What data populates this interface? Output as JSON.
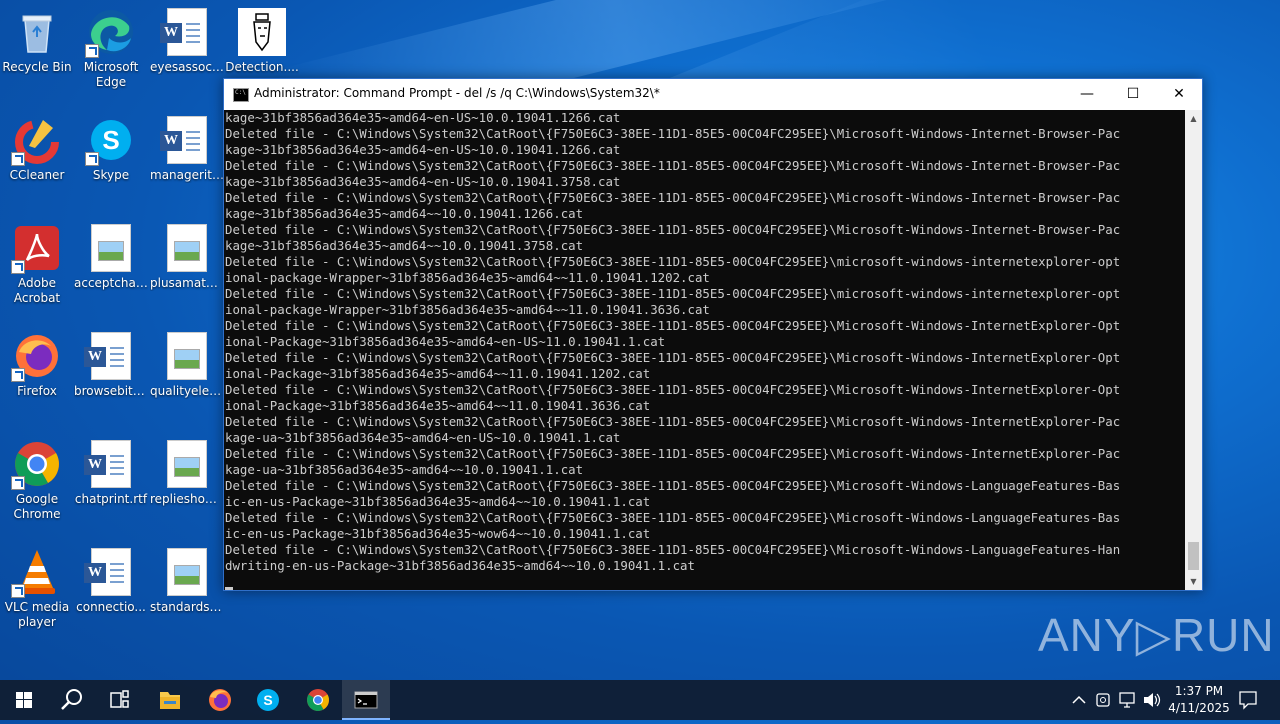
{
  "desktop": {
    "icons": [
      {
        "label": "Recycle Bin",
        "icon": "recycle-bin-icon"
      },
      {
        "label": "Microsoft Edge",
        "icon": "edge-icon"
      },
      {
        "label": "eyesassoci...",
        "icon": "word-doc-icon"
      },
      {
        "label": "Detection....",
        "icon": "image-file-icon"
      },
      {
        "label": "CCleaner",
        "icon": "ccleaner-icon"
      },
      {
        "label": "Skype",
        "icon": "skype-icon"
      },
      {
        "label": "managerite...",
        "icon": "word-doc-icon"
      },
      {
        "label": "Adobe Acrobat",
        "icon": "acrobat-icon"
      },
      {
        "label": "acceptchat....",
        "icon": "image-file-icon"
      },
      {
        "label": "plusamate....",
        "icon": "image-file-icon"
      },
      {
        "label": "Firefox",
        "icon": "firefox-icon"
      },
      {
        "label": "browsebit.rtf",
        "icon": "word-doc-icon"
      },
      {
        "label": "qualityelec...",
        "icon": "image-file-icon"
      },
      {
        "label": "Google Chrome",
        "icon": "chrome-icon"
      },
      {
        "label": "chatprint.rtf",
        "icon": "word-doc-icon"
      },
      {
        "label": "replieshous...",
        "icon": "image-file-icon"
      },
      {
        "label": "VLC media player",
        "icon": "vlc-icon"
      },
      {
        "label": "connectio...",
        "icon": "word-doc-icon"
      },
      {
        "label": "standardsc...",
        "icon": "image-file-icon"
      }
    ]
  },
  "window": {
    "title": "Administrator: Command Prompt - del  /s /q C:\\Windows\\System32\\*",
    "minimize": "—",
    "maximize": "☐",
    "close": "✕",
    "lines": [
      "kage~31bf3856ad364e35~amd64~en-US~10.0.19041.1266.cat",
      "Deleted file - C:\\Windows\\System32\\CatRoot\\{F750E6C3-38EE-11D1-85E5-00C04FC295EE}\\Microsoft-Windows-Internet-Browser-Pac",
      "kage~31bf3856ad364e35~amd64~en-US~10.0.19041.1266.cat",
      "Deleted file - C:\\Windows\\System32\\CatRoot\\{F750E6C3-38EE-11D1-85E5-00C04FC295EE}\\Microsoft-Windows-Internet-Browser-Pac",
      "kage~31bf3856ad364e35~amd64~en-US~10.0.19041.3758.cat",
      "Deleted file - C:\\Windows\\System32\\CatRoot\\{F750E6C3-38EE-11D1-85E5-00C04FC295EE}\\Microsoft-Windows-Internet-Browser-Pac",
      "kage~31bf3856ad364e35~amd64~~10.0.19041.1266.cat",
      "Deleted file - C:\\Windows\\System32\\CatRoot\\{F750E6C3-38EE-11D1-85E5-00C04FC295EE}\\Microsoft-Windows-Internet-Browser-Pac",
      "kage~31bf3856ad364e35~amd64~~10.0.19041.3758.cat",
      "Deleted file - C:\\Windows\\System32\\CatRoot\\{F750E6C3-38EE-11D1-85E5-00C04FC295EE}\\microsoft-windows-internetexplorer-opt",
      "ional-package-Wrapper~31bf3856ad364e35~amd64~~11.0.19041.1202.cat",
      "Deleted file - C:\\Windows\\System32\\CatRoot\\{F750E6C3-38EE-11D1-85E5-00C04FC295EE}\\microsoft-windows-internetexplorer-opt",
      "ional-package-Wrapper~31bf3856ad364e35~amd64~~11.0.19041.3636.cat",
      "Deleted file - C:\\Windows\\System32\\CatRoot\\{F750E6C3-38EE-11D1-85E5-00C04FC295EE}\\Microsoft-Windows-InternetExplorer-Opt",
      "ional-Package~31bf3856ad364e35~amd64~en-US~11.0.19041.1.cat",
      "Deleted file - C:\\Windows\\System32\\CatRoot\\{F750E6C3-38EE-11D1-85E5-00C04FC295EE}\\Microsoft-Windows-InternetExplorer-Opt",
      "ional-Package~31bf3856ad364e35~amd64~~11.0.19041.1202.cat",
      "Deleted file - C:\\Windows\\System32\\CatRoot\\{F750E6C3-38EE-11D1-85E5-00C04FC295EE}\\Microsoft-Windows-InternetExplorer-Opt",
      "ional-Package~31bf3856ad364e35~amd64~~11.0.19041.3636.cat",
      "Deleted file - C:\\Windows\\System32\\CatRoot\\{F750E6C3-38EE-11D1-85E5-00C04FC295EE}\\Microsoft-Windows-InternetExplorer-Pac",
      "kage-ua~31bf3856ad364e35~amd64~en-US~10.0.19041.1.cat",
      "Deleted file - C:\\Windows\\System32\\CatRoot\\{F750E6C3-38EE-11D1-85E5-00C04FC295EE}\\Microsoft-Windows-InternetExplorer-Pac",
      "kage-ua~31bf3856ad364e35~amd64~~10.0.19041.1.cat",
      "Deleted file - C:\\Windows\\System32\\CatRoot\\{F750E6C3-38EE-11D1-85E5-00C04FC295EE}\\Microsoft-Windows-LanguageFeatures-Bas",
      "ic-en-us-Package~31bf3856ad364e35~amd64~~10.0.19041.1.cat",
      "Deleted file - C:\\Windows\\System32\\CatRoot\\{F750E6C3-38EE-11D1-85E5-00C04FC295EE}\\Microsoft-Windows-LanguageFeatures-Bas",
      "ic-en-us-Package~31bf3856ad364e35~wow64~~10.0.19041.1.cat",
      "Deleted file - C:\\Windows\\System32\\CatRoot\\{F750E6C3-38EE-11D1-85E5-00C04FC295EE}\\Microsoft-Windows-LanguageFeatures-Han",
      "dwriting-en-us-Package~31bf3856ad364e35~amd64~~10.0.19041.1.cat"
    ]
  },
  "watermark": "ANY▷RUN",
  "taskbar": {
    "items": [
      "start-icon",
      "search-icon",
      "task-view-icon",
      "file-explorer-icon",
      "firefox-icon",
      "skype-icon",
      "chrome-icon",
      "command-prompt-icon"
    ],
    "clock_time": "1:37 PM",
    "clock_date": "4/11/2025"
  }
}
